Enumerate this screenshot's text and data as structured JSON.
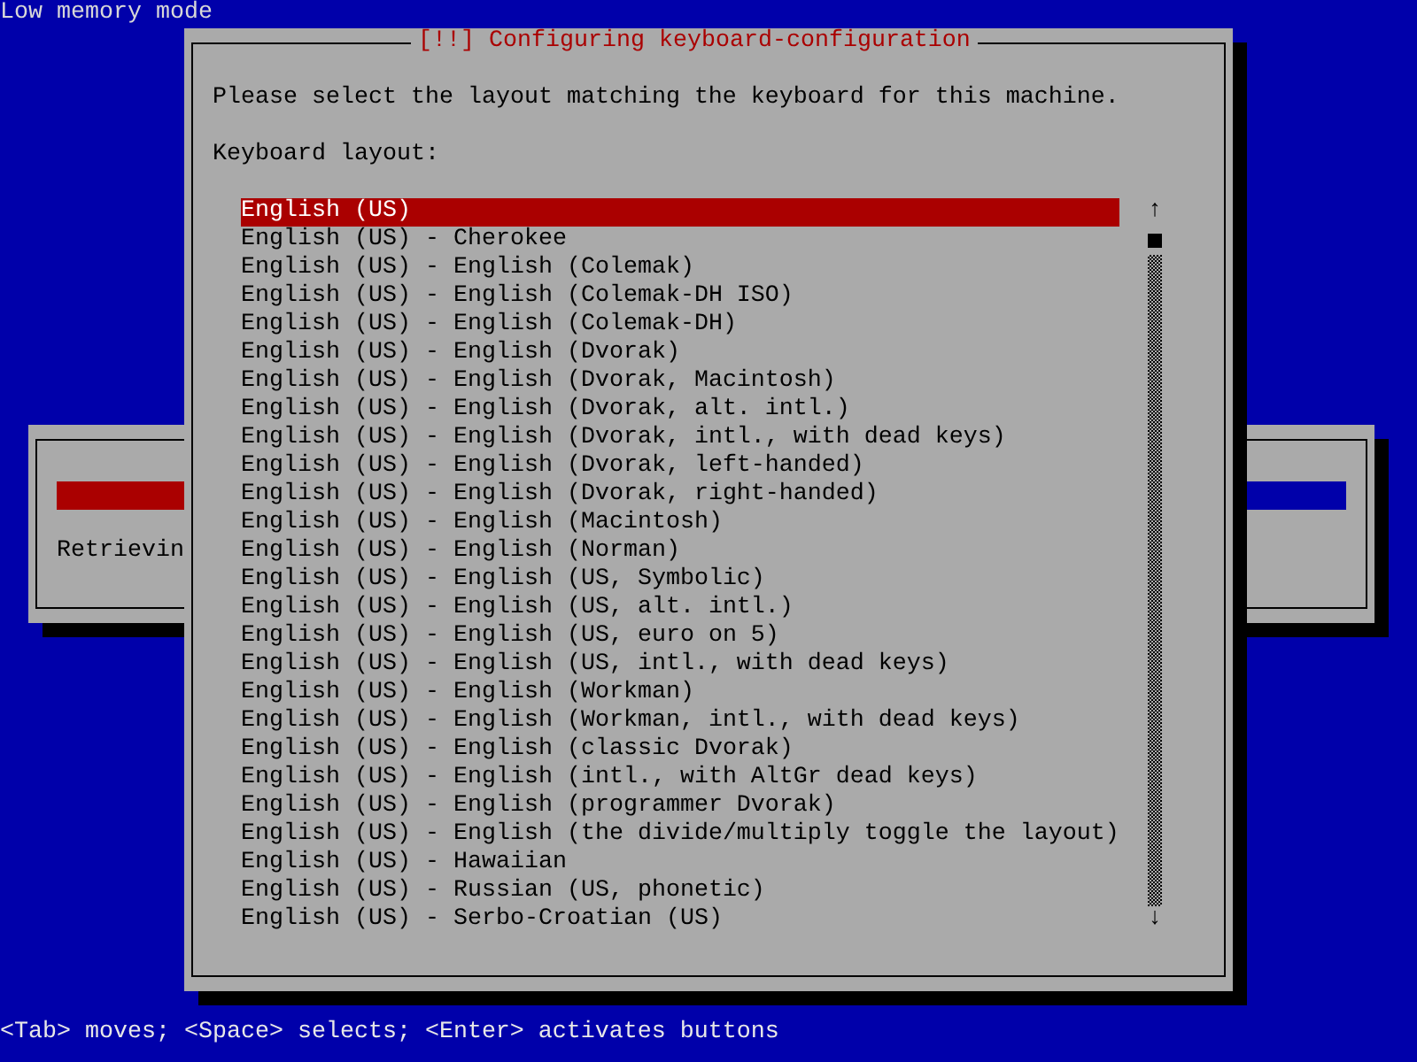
{
  "header": {
    "text": "Low memory mode"
  },
  "background_dialog": {
    "progress": {
      "level": 0.3
    },
    "status": "Retrievin"
  },
  "dialog": {
    "title": "[!!] Configuring keyboard-configuration",
    "prompt": "Please select the layout matching the keyboard for this machine.",
    "label": "Keyboard layout:",
    "options": [
      {
        "label": "English (US)",
        "selected": true
      },
      {
        "label": "English (US) - Cherokee",
        "selected": false
      },
      {
        "label": "English (US) - English (Colemak)",
        "selected": false
      },
      {
        "label": "English (US) - English (Colemak-DH ISO)",
        "selected": false
      },
      {
        "label": "English (US) - English (Colemak-DH)",
        "selected": false
      },
      {
        "label": "English (US) - English (Dvorak)",
        "selected": false
      },
      {
        "label": "English (US) - English (Dvorak, Macintosh)",
        "selected": false
      },
      {
        "label": "English (US) - English (Dvorak, alt. intl.)",
        "selected": false
      },
      {
        "label": "English (US) - English (Dvorak, intl., with dead keys)",
        "selected": false
      },
      {
        "label": "English (US) - English (Dvorak, left-handed)",
        "selected": false
      },
      {
        "label": "English (US) - English (Dvorak, right-handed)",
        "selected": false
      },
      {
        "label": "English (US) - English (Macintosh)",
        "selected": false
      },
      {
        "label": "English (US) - English (Norman)",
        "selected": false
      },
      {
        "label": "English (US) - English (US, Symbolic)",
        "selected": false
      },
      {
        "label": "English (US) - English (US, alt. intl.)",
        "selected": false
      },
      {
        "label": "English (US) - English (US, euro on 5)",
        "selected": false
      },
      {
        "label": "English (US) - English (US, intl., with dead keys)",
        "selected": false
      },
      {
        "label": "English (US) - English (Workman)",
        "selected": false
      },
      {
        "label": "English (US) - English (Workman, intl., with dead keys)",
        "selected": false
      },
      {
        "label": "English (US) - English (classic Dvorak)",
        "selected": false
      },
      {
        "label": "English (US) - English (intl., with AltGr dead keys)",
        "selected": false
      },
      {
        "label": "English (US) - English (programmer Dvorak)",
        "selected": false
      },
      {
        "label": "English (US) - English (the divide/multiply toggle the layout)",
        "selected": false
      },
      {
        "label": "English (US) - Hawaiian",
        "selected": false
      },
      {
        "label": "English (US) - Russian (US, phonetic)",
        "selected": false
      },
      {
        "label": "English (US) - Serbo-Croatian (US)",
        "selected": false
      }
    ],
    "scrollbar": {
      "up": "↑",
      "down": "↓"
    }
  },
  "status_bar": {
    "text": "<Tab> moves; <Space> selects; <Enter> activates buttons"
  }
}
